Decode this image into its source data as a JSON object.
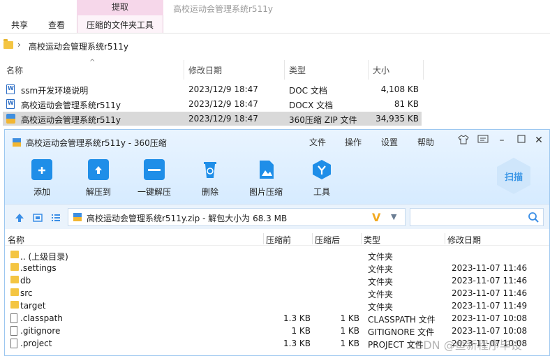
{
  "explorer": {
    "window_title": "高校运动会管理系统r511y",
    "context_tab": "提取",
    "ribbon_tabs": [
      "共享",
      "查看",
      "压缩的文件夹工具"
    ],
    "address": "高校运动会管理系统r511y",
    "columns": {
      "name": "名称",
      "date": "修改日期",
      "type": "类型",
      "size": "大小"
    },
    "files": [
      {
        "name": "ssm开发环境说明",
        "date": "2023/12/9 18:47",
        "type": "DOC 文档",
        "size": "4,108 KB",
        "icon": "word-doc-icon"
      },
      {
        "name": "高校运动会管理系统r511y",
        "date": "2023/12/9 18:47",
        "type": "DOCX 文档",
        "size": "81 KB",
        "icon": "word-doc-icon"
      },
      {
        "name": "高校运动会管理系统r511y",
        "date": "2023/12/9 18:47",
        "type": "360压缩 ZIP 文件",
        "size": "34,935 KB",
        "icon": "zip-icon"
      }
    ]
  },
  "zip_window": {
    "title": "高校运动会管理系统r511y - 360压缩",
    "menu": [
      "文件",
      "操作",
      "设置",
      "帮助"
    ],
    "toolbar": [
      "添加",
      "解压到",
      "一键解压",
      "删除",
      "图片压缩",
      "工具"
    ],
    "scan_label": "扫描",
    "path_text": "高校运动会管理系统r511y.zip - 解包大小为 68.3 MB",
    "columns": {
      "name": "名称",
      "compressed": "压缩前",
      "after": "压缩后",
      "type": "类型",
      "date": "修改日期"
    },
    "rows": [
      {
        "name": ".. (上级目录)",
        "before": "",
        "after": "",
        "type": "文件夹",
        "date": "",
        "kind": "folder"
      },
      {
        "name": ".settings",
        "before": "",
        "after": "",
        "type": "文件夹",
        "date": "2023-11-07 11:46",
        "kind": "folder"
      },
      {
        "name": "db",
        "before": "",
        "after": "",
        "type": "文件夹",
        "date": "2023-11-07 11:46",
        "kind": "folder"
      },
      {
        "name": "src",
        "before": "",
        "after": "",
        "type": "文件夹",
        "date": "2023-11-07 11:46",
        "kind": "folder"
      },
      {
        "name": "target",
        "before": "",
        "after": "",
        "type": "文件夹",
        "date": "2023-11-07 11:49",
        "kind": "folder"
      },
      {
        "name": ".classpath",
        "before": "1.3 KB",
        "after": "1 KB",
        "type": "CLASSPATH 文件",
        "date": "2023-11-07 10:08",
        "kind": "file"
      },
      {
        "name": ".gitignore",
        "before": "1 KB",
        "after": "1 KB",
        "type": "GITIGNORE 文件",
        "date": "2023-11-07 10:08",
        "kind": "file"
      },
      {
        "name": ".project",
        "before": "1.3 KB",
        "after": "1 KB",
        "type": "PROJECT 文件",
        "date": "2023-11-07 10:08",
        "kind": "file"
      }
    ]
  },
  "watermark": "CSDN @鱼新程序毕设",
  "colors": {
    "accent": "#1f8ee8",
    "context_tab": "#f6d7ea",
    "selection": "#d9d9d9"
  }
}
